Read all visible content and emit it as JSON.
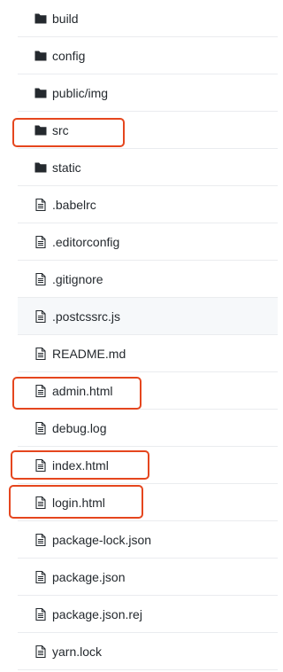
{
  "colors": {
    "highlight": "#e5461e",
    "text": "#24292e",
    "icon": "#24292e",
    "row_border": "#eaecef",
    "row_hover_bg": "#f6f8fa"
  },
  "files": [
    {
      "name": "build",
      "type": "folder",
      "icon": "folder-icon",
      "highlighted": false
    },
    {
      "name": "config",
      "type": "folder",
      "icon": "folder-icon",
      "highlighted": false
    },
    {
      "name": "public/img",
      "type": "folder",
      "icon": "folder-icon",
      "highlighted": false
    },
    {
      "name": "src",
      "type": "folder",
      "icon": "folder-icon",
      "highlighted": true
    },
    {
      "name": "static",
      "type": "folder",
      "icon": "folder-icon",
      "highlighted": false
    },
    {
      "name": ".babelrc",
      "type": "file",
      "icon": "file-icon",
      "highlighted": false
    },
    {
      "name": ".editorconfig",
      "type": "file",
      "icon": "file-icon",
      "highlighted": false
    },
    {
      "name": ".gitignore",
      "type": "file",
      "icon": "file-icon",
      "highlighted": false
    },
    {
      "name": ".postcssrc.js",
      "type": "file",
      "icon": "file-icon",
      "highlighted": false,
      "hovered": true
    },
    {
      "name": "README.md",
      "type": "file",
      "icon": "file-icon",
      "highlighted": false
    },
    {
      "name": "admin.html",
      "type": "file",
      "icon": "file-icon",
      "highlighted": true
    },
    {
      "name": "debug.log",
      "type": "file",
      "icon": "file-icon",
      "highlighted": false
    },
    {
      "name": "index.html",
      "type": "file",
      "icon": "file-icon",
      "highlighted": true
    },
    {
      "name": "login.html",
      "type": "file",
      "icon": "file-icon",
      "highlighted": true
    },
    {
      "name": "package-lock.json",
      "type": "file",
      "icon": "file-icon",
      "highlighted": false
    },
    {
      "name": "package.json",
      "type": "file",
      "icon": "file-icon",
      "highlighted": false
    },
    {
      "name": "package.json.rej",
      "type": "file",
      "icon": "file-icon",
      "highlighted": false
    },
    {
      "name": "yarn.lock",
      "type": "file",
      "icon": "file-icon",
      "highlighted": false
    }
  ]
}
